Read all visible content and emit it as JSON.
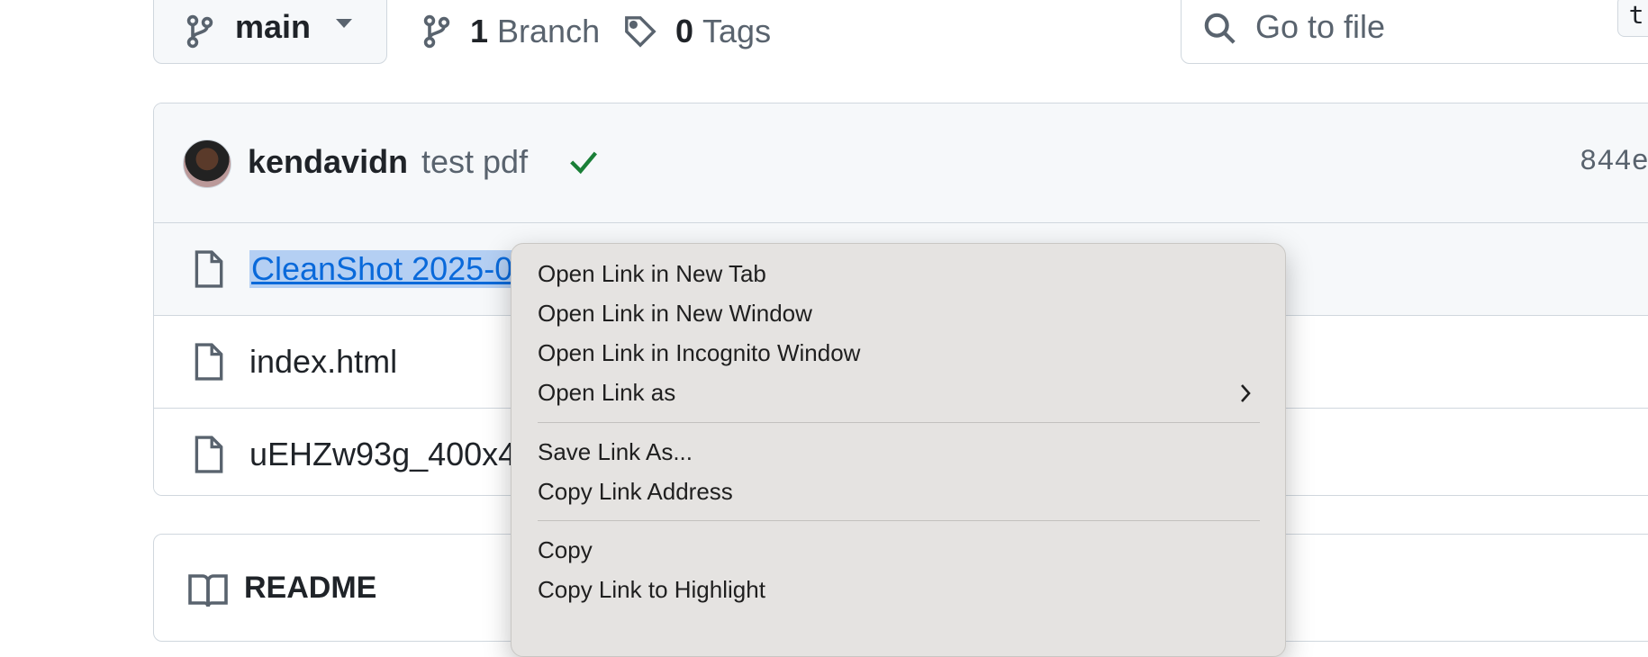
{
  "branch": {
    "name": "main"
  },
  "meta": {
    "branch_count": "1",
    "branch_label": "Branch",
    "tag_count": "0",
    "tag_label": "Tags"
  },
  "search": {
    "placeholder": "Go to file",
    "shortcut": "t"
  },
  "commit": {
    "author": "kendavidn",
    "message": "test pdf",
    "sha": "844e"
  },
  "files": [
    {
      "name": "CleanShot 2025-0",
      "highlighted": true
    },
    {
      "name": "index.html"
    },
    {
      "name": "uEHZw93g_400x4"
    }
  ],
  "readme": {
    "title": "README"
  },
  "context_menu": {
    "items": [
      "Open Link in New Tab",
      "Open Link in New Window",
      "Open Link in Incognito Window",
      "Open Link as",
      "Save Link As...",
      "Copy Link Address",
      "Copy",
      "Copy Link to Highlight"
    ]
  },
  "colors": {
    "link": "#0969da",
    "success": "#1a7f37",
    "border": "#d0d7de",
    "menu_bg": "#e5e3e1"
  }
}
